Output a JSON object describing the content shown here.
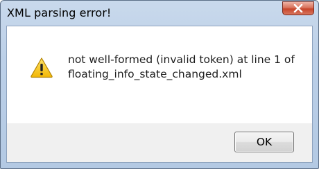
{
  "window": {
    "title": "XML parsing error!"
  },
  "dialog": {
    "icon": "warning-icon",
    "message_line1": "not well-formed (invalid token) at line 1 of",
    "message_line2": "floating_info_state_changed.xml",
    "ok_label": "OK"
  },
  "colors": {
    "warning_yellow": "#f5c518",
    "close_red": "#c8452b"
  }
}
